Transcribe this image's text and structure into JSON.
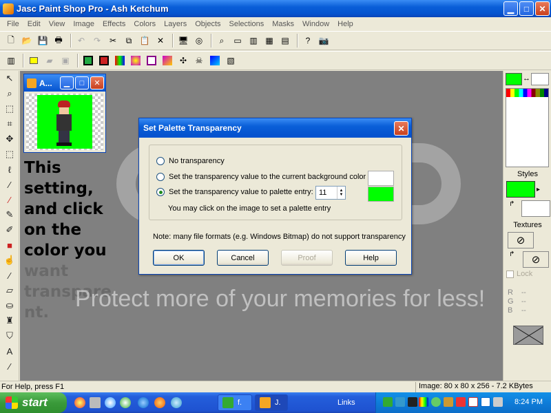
{
  "window": {
    "title": "Jasc Paint Shop Pro - Ash Ketchum"
  },
  "menu": [
    "File",
    "Edit",
    "View",
    "Image",
    "Effects",
    "Colors",
    "Layers",
    "Objects",
    "Selections",
    "Masks",
    "Window",
    "Help"
  ],
  "image_window": {
    "title": "A..."
  },
  "annotation": {
    "lines": [
      "This",
      "setting,",
      "and click",
      "on the",
      "color you"
    ],
    "ghost_lines": [
      "want",
      "transpare",
      "nt."
    ]
  },
  "watermark": "Protect more of your memories for less!",
  "dialog": {
    "title": "Set Palette Transparency",
    "option_none": "No transparency",
    "option_background": "Set the transparency value to the current background color",
    "option_palette": "Set the transparency value to palette entry:",
    "palette_entry": "11",
    "hint": "You may click on the image to set a palette entry",
    "note": "Note:  many file formats (e.g. Windows Bitmap) do not support transparency",
    "ok": "OK",
    "cancel": "Cancel",
    "proof": "Proof",
    "help": "Help"
  },
  "right_panel": {
    "styles_label": "Styles",
    "textures_label": "Textures",
    "lock_label": "Lock",
    "r": "R",
    "g": "G",
    "b": "B",
    "r_val": "--",
    "g_val": "--",
    "b_val": "--"
  },
  "status": {
    "help": "For Help, press F1",
    "info": "Image:  80 x 80 x 256 - 7.2 KBytes"
  },
  "taskbar": {
    "start": "start",
    "task1": "f.",
    "task2": "J.",
    "links": "Links",
    "clock": "8:24 PM"
  },
  "colors": {
    "foreground": "#00ff00",
    "xp_blue": "#0553cf"
  }
}
